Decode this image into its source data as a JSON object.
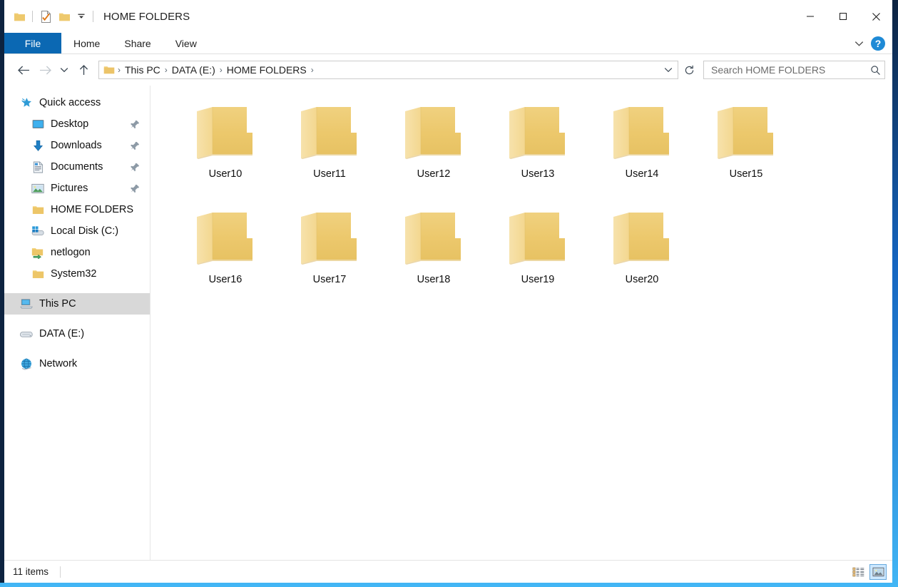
{
  "window": {
    "title": "HOME FOLDERS",
    "accent_color": "#0b68b3",
    "folder_color": "#eac96a"
  },
  "quick_access_toolbar": {
    "items": [
      {
        "icon": "folder-icon",
        "name": "qat-explorer-icon"
      },
      {
        "icon": "properties-icon",
        "name": "qat-properties-icon"
      },
      {
        "icon": "new-folder-icon",
        "name": "qat-new-folder-icon"
      }
    ],
    "customize_label": "▾"
  },
  "window_controls": {
    "minimize": "—",
    "maximize": "□",
    "close": "✕"
  },
  "ribbon": {
    "tabs": [
      {
        "label": "File",
        "active": true
      },
      {
        "label": "Home",
        "active": false
      },
      {
        "label": "Share",
        "active": false
      },
      {
        "label": "View",
        "active": false
      }
    ],
    "expand_label": "∨",
    "help_label": "?"
  },
  "navigation": {
    "back_label": "←",
    "forward_label": "→",
    "recent_label": "∨",
    "up_label": "↑",
    "breadcrumb": [
      {
        "label": "This PC"
      },
      {
        "label": "DATA (E:)"
      },
      {
        "label": "HOME FOLDERS"
      }
    ],
    "breadcrumb_separator": "›",
    "dropdown_label": "∨",
    "refresh_label": "↻"
  },
  "search": {
    "placeholder": "Search HOME FOLDERS",
    "value": "",
    "icon": "search-icon"
  },
  "sidebar": {
    "groups": [
      {
        "items": [
          {
            "label": "Quick access",
            "icon": "star-icon",
            "level": 1,
            "pinned": false,
            "selected": false
          },
          {
            "label": "Desktop",
            "icon": "desktop-icon",
            "level": 2,
            "pinned": true,
            "selected": false
          },
          {
            "label": "Downloads",
            "icon": "download-icon",
            "level": 2,
            "pinned": true,
            "selected": false
          },
          {
            "label": "Documents",
            "icon": "document-icon",
            "level": 2,
            "pinned": true,
            "selected": false
          },
          {
            "label": "Pictures",
            "icon": "picture-icon",
            "level": 2,
            "pinned": true,
            "selected": false
          },
          {
            "label": "HOME FOLDERS",
            "icon": "folder-icon",
            "level": 2,
            "pinned": false,
            "selected": false
          },
          {
            "label": "Local Disk (C:)",
            "icon": "windows-disk-icon",
            "level": 2,
            "pinned": false,
            "selected": false
          },
          {
            "label": "netlogon",
            "icon": "shared-folder-icon",
            "level": 2,
            "pinned": false,
            "selected": false
          },
          {
            "label": "System32",
            "icon": "folder-icon",
            "level": 2,
            "pinned": false,
            "selected": false
          }
        ]
      },
      {
        "items": [
          {
            "label": "This PC",
            "icon": "this-pc-icon",
            "level": 1,
            "pinned": false,
            "selected": true
          }
        ]
      },
      {
        "items": [
          {
            "label": "DATA (E:)",
            "icon": "drive-icon",
            "level": 1,
            "pinned": false,
            "selected": false
          }
        ]
      },
      {
        "items": [
          {
            "label": "Network",
            "icon": "network-icon",
            "level": 1,
            "pinned": false,
            "selected": false
          }
        ]
      }
    ]
  },
  "content": {
    "items": [
      {
        "label": "User10",
        "type": "folder"
      },
      {
        "label": "User11",
        "type": "folder"
      },
      {
        "label": "User12",
        "type": "folder"
      },
      {
        "label": "User13",
        "type": "folder"
      },
      {
        "label": "User14",
        "type": "folder"
      },
      {
        "label": "User15",
        "type": "folder"
      },
      {
        "label": "User16",
        "type": "folder"
      },
      {
        "label": "User17",
        "type": "folder"
      },
      {
        "label": "User18",
        "type": "folder"
      },
      {
        "label": "User19",
        "type": "folder"
      },
      {
        "label": "User20",
        "type": "folder"
      }
    ]
  },
  "statusbar": {
    "count_text": "11 items",
    "views": [
      {
        "name": "details-view",
        "active": false
      },
      {
        "name": "large-icons-view",
        "active": true
      }
    ]
  }
}
